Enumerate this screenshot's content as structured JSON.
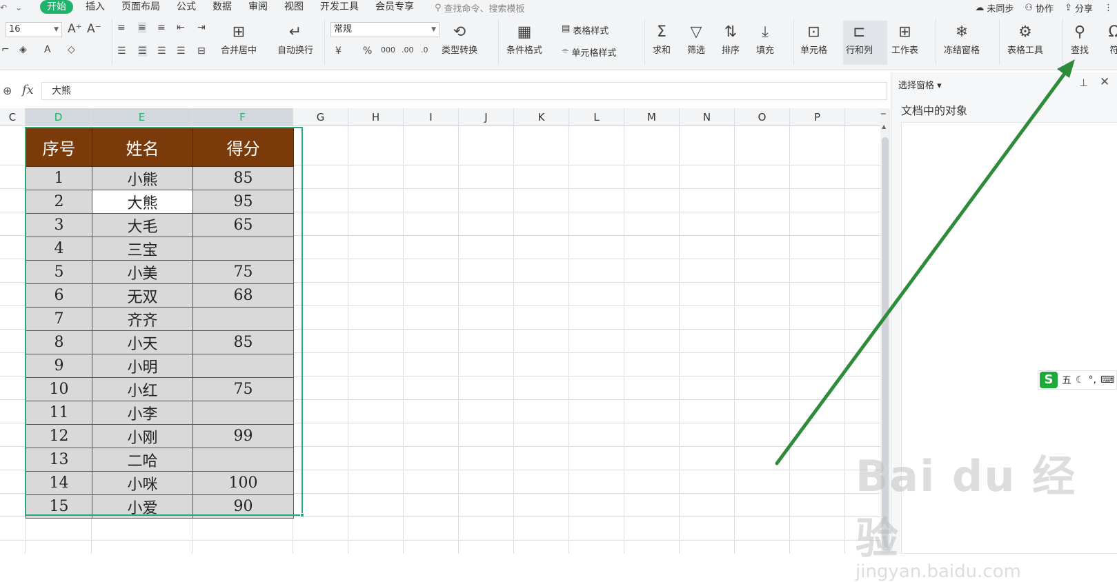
{
  "menubar": {
    "tabs": [
      "开始",
      "插入",
      "页面布局",
      "公式",
      "数据",
      "审阅",
      "视图",
      "开发工具",
      "会员专享"
    ],
    "active_tab": "开始",
    "search_placeholder": "查找命令、搜索模板",
    "sync": "未同步",
    "collab": "协作",
    "share": "分享"
  },
  "ribbon": {
    "font_size": "16",
    "number_format": "常规",
    "merge_center": "合并居中",
    "auto_wrap": "自动换行",
    "type_convert": "类型转换",
    "cond_format": "条件格式",
    "table_style": "表格样式",
    "cell_style": "单元格样式",
    "sum": "求和",
    "filter": "筛选",
    "sort": "排序",
    "fill": "填充",
    "cell": "单元格",
    "row_col": "行和列",
    "worksheet": "工作表",
    "freeze": "冻结窗格",
    "table_tools": "表格工具",
    "find": "查找",
    "symbol": "符"
  },
  "formula_bar": {
    "fx": "fx",
    "value": "大熊"
  },
  "columns": [
    "C",
    "D",
    "E",
    "F",
    "G",
    "H",
    "I",
    "J",
    "K",
    "L",
    "M",
    "N",
    "O",
    "P"
  ],
  "selected_columns": [
    "D",
    "E",
    "F"
  ],
  "table": {
    "headers": [
      "序号",
      "姓名",
      "得分"
    ],
    "rows": [
      [
        "1",
        "小熊",
        "85"
      ],
      [
        "2",
        "大熊",
        "95"
      ],
      [
        "3",
        "大毛",
        "65"
      ],
      [
        "4",
        "三宝",
        ""
      ],
      [
        "5",
        "小美",
        "75"
      ],
      [
        "6",
        "无双",
        "68"
      ],
      [
        "7",
        "齐齐",
        ""
      ],
      [
        "8",
        "小天",
        "85"
      ],
      [
        "9",
        "小明",
        ""
      ],
      [
        "10",
        "小红",
        "75"
      ],
      [
        "11",
        "小李",
        ""
      ],
      [
        "12",
        "小刚",
        "99"
      ],
      [
        "13",
        "二哈",
        ""
      ],
      [
        "14",
        "小咪",
        "100"
      ],
      [
        "15",
        "小爱",
        "90"
      ]
    ],
    "active_row": 1,
    "active_col": 1
  },
  "pane": {
    "title": "选择窗格",
    "subtitle": "文档中的对象"
  },
  "ime": {
    "logo": "S",
    "mode": "五"
  },
  "watermark": {
    "brand": "Bai du 经验",
    "url": "jingyan.baidu.com"
  },
  "colors": {
    "accent": "#1fb36b",
    "header_fill": "#7b3a0a",
    "cell_fill": "#d9d9d9",
    "selection": "#2aa876",
    "arrow": "#2e8b3a"
  }
}
